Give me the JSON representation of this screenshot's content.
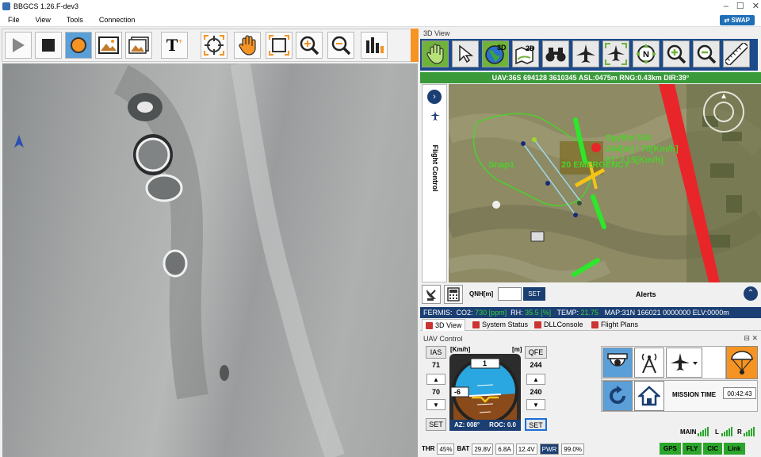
{
  "window": {
    "title": "BBGCS 1.26.F-dev3"
  },
  "menu": [
    "File",
    "View",
    "Tools",
    "Connection"
  ],
  "swap_label": "SWAP",
  "video_toolbar": {
    "buttons": [
      "play-icon",
      "stop-icon",
      "record-icon",
      "image-icon",
      "gallery-icon",
      "text-add-icon",
      "target-icon",
      "hand-icon",
      "fit-icon",
      "zoom-in-icon",
      "zoom-out-icon",
      "bar-chart-icon"
    ]
  },
  "view3d": {
    "panel_title": "3D View",
    "toolbar": [
      "hand-icon",
      "pointer-icon",
      "globe-3d-icon",
      "map-2d-icon",
      "binoculars-icon",
      "plane-icon",
      "plane-center-icon",
      "north-icon",
      "zoom-in-icon",
      "zoom-out-icon",
      "ruler-icon"
    ],
    "globe_label": "3D",
    "map2d_label": "2D",
    "north_label": "N",
    "info": "UAV:36S 694128 3610345 ASL:0475m RNG:0.43km DIR:39°",
    "side_label": "Flight Control",
    "map_labels": {
      "snap": "Snap1",
      "emergency": "20 EMERGENCY",
      "target_name": "Spylite 534",
      "target_line1": "244[m] / 70[Km/h]",
      "target_line2": "81° / 15[Km/h]"
    }
  },
  "alerts": {
    "qnh_label": "QNH[m]",
    "qnh_value": "",
    "set_label": "SET",
    "alerts_label": "Alerts"
  },
  "fermis": {
    "prefix": "FERMIS:",
    "co2_label": "CO2:",
    "co2_value": "730 [ppm]",
    "rh_label": "RH:",
    "rh_value": "35.5 [%]",
    "temp_label": "TEMP:",
    "temp_value": "21.75",
    "map": "MAP:31N 166021 0000000 ELV:0000m"
  },
  "tabs": [
    "3D View",
    "System Status",
    "DLLConsole",
    "Flight Plans"
  ],
  "uav_control": {
    "title": "UAV Control",
    "ias_label": "IAS",
    "ias_value": "71",
    "speed_unit": "[Km/h]",
    "alt_unit": "[m]",
    "qfe_label": "QFE",
    "qfe_value": "244",
    "speed_set": "70",
    "alt_set": "240",
    "set_label": "SET",
    "horizon_top": "1",
    "horizon_left": "-6",
    "az_label": "AZ: 008°",
    "roc_label": "ROC: 0.0",
    "mission_time_label": "MISSION TIME",
    "mission_time": "00:42:43"
  },
  "status": {
    "thr_label": "THR",
    "thr_value": "45%",
    "bat_label": "BAT",
    "bat_v": "29.8V",
    "bat_a": "6.8A",
    "bat_v2": "12.4V",
    "pwr_label": "PWR",
    "pwr_value": "99.0%",
    "main_label": "MAIN",
    "l_label": "L",
    "r_label": "R",
    "indicators": [
      "GPS",
      "FLY",
      "CIC",
      "Link"
    ]
  },
  "colors": {
    "accent_blue": "#1b4b8a",
    "orange": "#f59323",
    "green": "#2ba52b",
    "info_green": "#3a9a3a",
    "red_band": "#e8262a"
  }
}
